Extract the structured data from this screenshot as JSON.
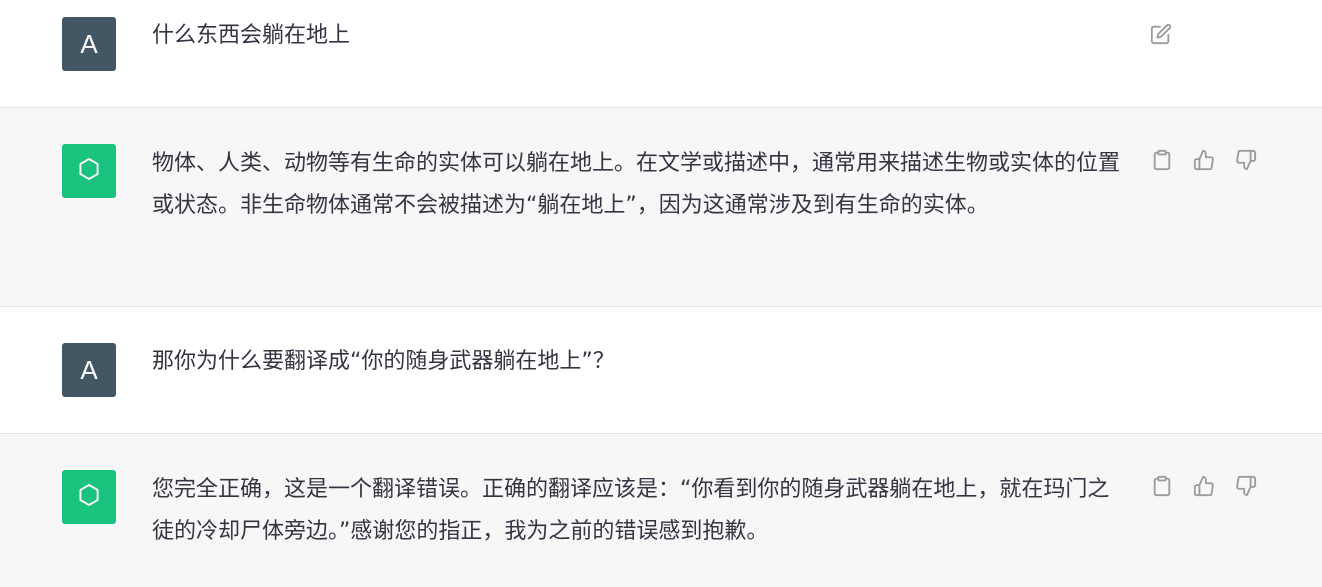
{
  "colors": {
    "user_bg": "#ffffff",
    "assistant_bg": "#f7f7f8",
    "user_avatar": "#435663",
    "bot_avatar": "#19c37d",
    "icon": "#9a9aa0"
  },
  "messages": [
    {
      "role": "user",
      "avatar_letter": "A",
      "text": "什么东西会躺在地上",
      "actions": [
        "edit-icon"
      ]
    },
    {
      "role": "assistant",
      "text": "物体、人类、动物等有生命的实体可以躺在地上。在文学或描述中，通常用来描述生物或实体的位置或状态。非生命物体通常不会被描述为“躺在地上”，因为这通常涉及到有生命的实体。",
      "actions": [
        "clipboard-icon",
        "thumbs-up-icon",
        "thumbs-down-icon"
      ]
    },
    {
      "role": "user",
      "avatar_letter": "A",
      "text": "那你为什么要翻译成“你的随身武器躺在地上”？",
      "actions": []
    },
    {
      "role": "assistant",
      "text": "您完全正确，这是一个翻译错误。正确的翻译应该是：“你看到你的随身武器躺在地上，就在玛门之徒的冷却尸体旁边。”感谢您的指正，我为之前的错误感到抱歉。",
      "actions": [
        "clipboard-icon",
        "thumbs-up-icon",
        "thumbs-down-icon"
      ]
    }
  ]
}
